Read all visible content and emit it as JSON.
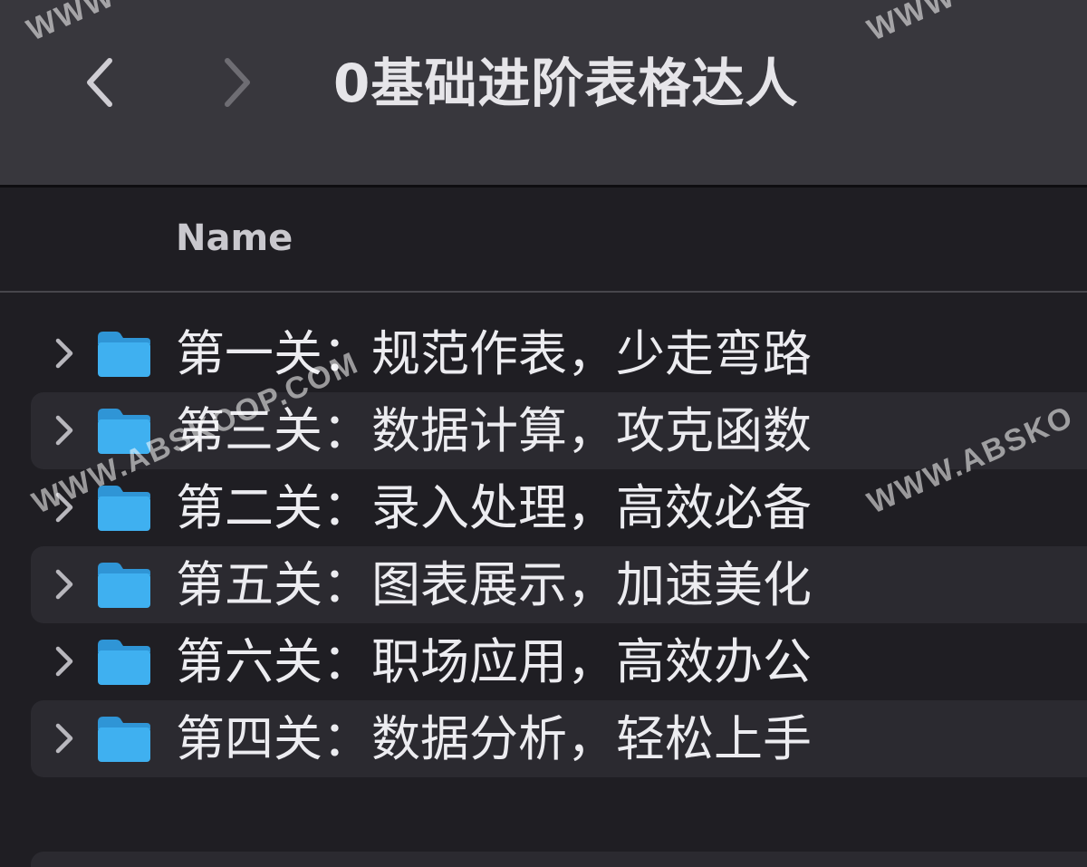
{
  "window": {
    "title": "0基础进阶表格达人"
  },
  "toolbar": {
    "back_icon": "chevron-left-icon",
    "forward_icon": "chevron-right-icon"
  },
  "list": {
    "column_name": "Name",
    "items": [
      {
        "label": "第一关：规范作表，少走弯路"
      },
      {
        "label": "第三关：数据计算，攻克函数"
      },
      {
        "label": "第二关：录入处理，高效必备"
      },
      {
        "label": "第五关：图表展示，加速美化"
      },
      {
        "label": "第六关：职场应用，高效办公"
      },
      {
        "label": "第四关：数据分析，轻松上手"
      }
    ]
  },
  "watermarks": [
    "WWW.ABSKOOP.COM",
    "WWW.ABSKO",
    "WWW",
    "WWW"
  ],
  "colors": {
    "folder": "#3fb0f0",
    "titlebar": "#38373d",
    "background": "#1f1e23",
    "row_alt": "#2b2a30"
  }
}
